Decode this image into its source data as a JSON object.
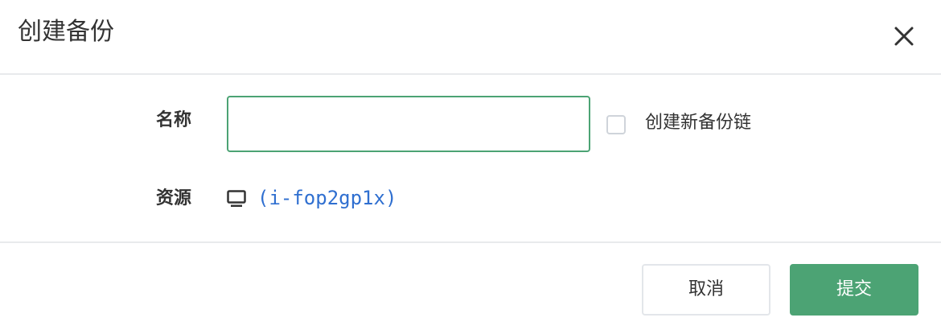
{
  "dialog": {
    "title": "创建备份"
  },
  "form": {
    "name_label": "名称",
    "name_value": "",
    "name_placeholder": "",
    "new_chain_label": "创建新备份链",
    "new_chain_checked": false,
    "resource_label": "资源",
    "resource_icon": "monitor-icon",
    "resource_value": "(i-fop2gp1x)"
  },
  "footer": {
    "cancel_label": "取消",
    "submit_label": "提交"
  },
  "colors": {
    "accent": "#4ca374",
    "link": "#2f6fd0"
  }
}
